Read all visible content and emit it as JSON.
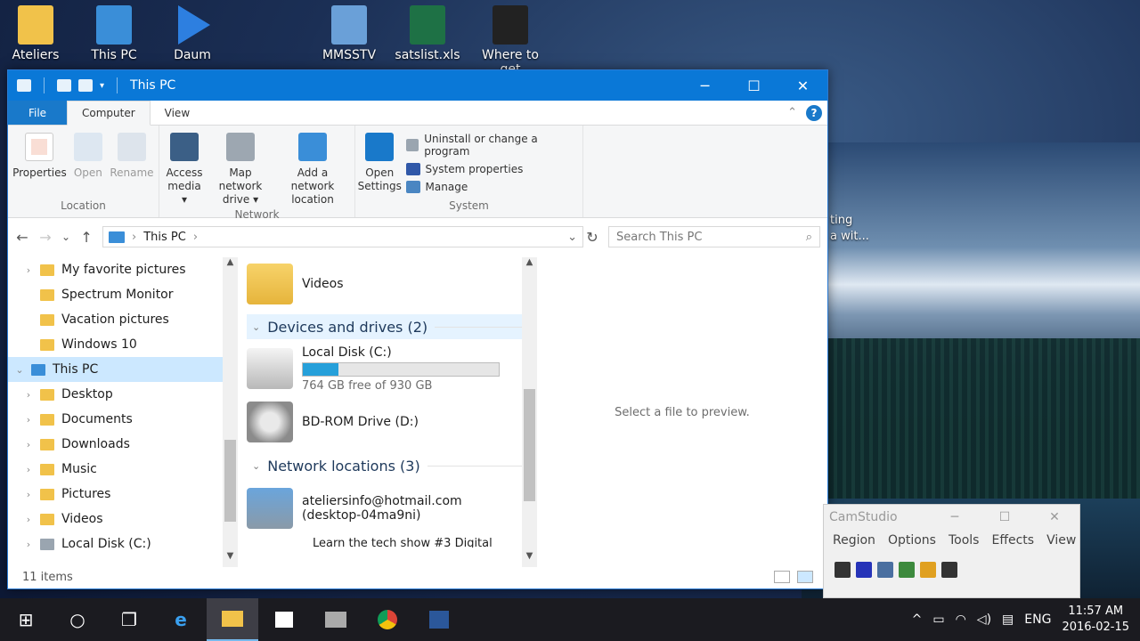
{
  "desktop": {
    "icons": [
      {
        "label": "Ateliers",
        "color": "#f1c24a"
      },
      {
        "label": "This PC",
        "color": "#3a8ed8"
      },
      {
        "label": "Daum",
        "color": "#2d7fe0"
      },
      {
        "label": "MMSSTV",
        "color": "#6aa0d8"
      },
      {
        "label": "satslist.xls",
        "color": "#1e7145"
      },
      {
        "label": "Where to get",
        "color": "#222222"
      }
    ],
    "partial_text_1": "ting",
    "partial_text_2": "a wit..."
  },
  "window": {
    "title": "This PC",
    "minimize": "─",
    "maximize": "☐",
    "close": "✕",
    "tabs": [
      "File",
      "Computer",
      "View"
    ],
    "help": "?",
    "collapse": "⌃"
  },
  "ribbon": {
    "location": {
      "label": "Location",
      "buttons": [
        {
          "label": "Properties"
        },
        {
          "label": "Open"
        },
        {
          "label": "Rename"
        }
      ]
    },
    "network": {
      "label": "Network",
      "buttons": [
        {
          "label": "Access media ▾"
        },
        {
          "label": "Map network drive ▾"
        },
        {
          "label": "Add a network location"
        }
      ]
    },
    "system": {
      "label": "System",
      "open_settings": "Open Settings",
      "items": [
        "Uninstall or change a program",
        "System properties",
        "Manage"
      ]
    }
  },
  "address": {
    "back": "←",
    "forward": "→",
    "recent": "⌄",
    "up": "↑",
    "path": "This PC",
    "sep": "›",
    "dropdown": "⌄",
    "refresh": "↻",
    "search_placeholder": "Search This PC",
    "search_icon": "⌕"
  },
  "nav_tree": [
    {
      "label": "My favorite pictures",
      "expander": "›",
      "icon": "folder"
    },
    {
      "label": "Spectrum Monitor",
      "expander": "",
      "icon": "folder"
    },
    {
      "label": "Vacation pictures",
      "expander": "",
      "icon": "folder"
    },
    {
      "label": "Windows 10",
      "expander": "",
      "icon": "folder"
    },
    {
      "label": "This PC",
      "expander": "⌄",
      "icon": "pc",
      "selected": true
    },
    {
      "label": "Desktop",
      "expander": "›",
      "icon": "folder"
    },
    {
      "label": "Documents",
      "expander": "›",
      "icon": "folder"
    },
    {
      "label": "Downloads",
      "expander": "›",
      "icon": "folder"
    },
    {
      "label": "Music",
      "expander": "›",
      "icon": "folder"
    },
    {
      "label": "Pictures",
      "expander": "›",
      "icon": "folder"
    },
    {
      "label": "Videos",
      "expander": "›",
      "icon": "folder"
    },
    {
      "label": "Local Disk (C:)",
      "expander": "›",
      "icon": "disk"
    }
  ],
  "content": {
    "videos_label": "Videos",
    "devices_header": "Devices and drives (2)",
    "local_disk": {
      "name": "Local Disk (C:)",
      "free_text": "764 GB free of 930 GB",
      "used_fraction": 0.18
    },
    "bd_rom": "BD-ROM Drive (D:)",
    "network_header": "Network locations (3)",
    "network_item": {
      "line1": "ateliersinfo@hotmail.com",
      "line2": "(desktop-04ma9ni)"
    },
    "network_item2": "Learn the tech show #3 Digital"
  },
  "preview_text": "Select a file to preview.",
  "status": {
    "count": "11 items"
  },
  "camstudio": {
    "title": "CamStudio",
    "menu": [
      "Region",
      "Options",
      "Tools",
      "Effects",
      "View"
    ]
  },
  "taskbar": {
    "start": "⊞",
    "search": "○",
    "taskview": "❐",
    "language": "ENG",
    "time": "11:57 AM",
    "date": "2016-02-15"
  }
}
